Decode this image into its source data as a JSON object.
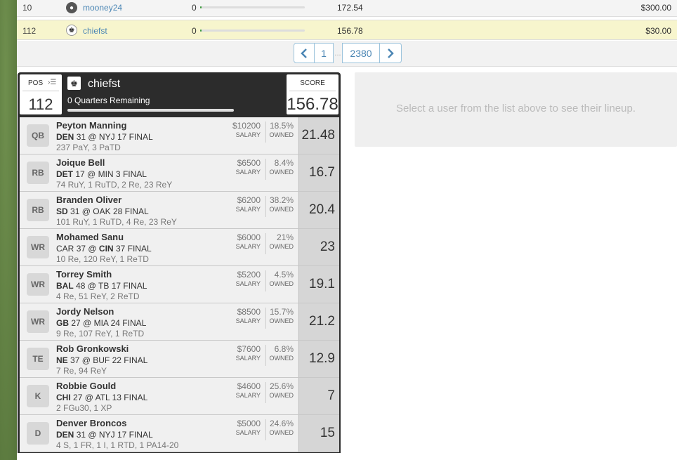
{
  "standings": [
    {
      "rank": "10",
      "username": "mooney24",
      "remaining": "0",
      "remaining_pct": 1,
      "points": "172.54",
      "prize": "$300.00"
    },
    {
      "rank": "112",
      "username": "chiefst",
      "remaining": "0",
      "remaining_pct": 1,
      "points": "156.78",
      "prize": "$30.00"
    }
  ],
  "pagination": {
    "first": "1",
    "dots": "...",
    "last": "2380"
  },
  "lineup": {
    "pos_label": "POS",
    "position": "112",
    "username": "chiefst",
    "quarters_remaining": "0 Quarters Remaining",
    "score_label": "SCORE",
    "score": "156.78",
    "salary_label": "SALARY",
    "owned_label": "OWNED",
    "players": [
      {
        "pos": "QB",
        "name": "Peyton Manning",
        "team": "DEN",
        "team_score": "31",
        "sep": "@",
        "opp": "NYJ",
        "opp_score": "17",
        "status": "FINAL",
        "stats": "237 PaY, 3 PaTD",
        "salary": "$10200",
        "owned": "18.5%",
        "points": "21.48",
        "bold": "team"
      },
      {
        "pos": "RB",
        "name": "Joique Bell",
        "team": "DET",
        "team_score": "17",
        "sep": "@",
        "opp": "MIN",
        "opp_score": "3",
        "status": "FINAL",
        "stats": "74 RuY, 1 RuTD, 2 Re, 23 ReY",
        "salary": "$6500",
        "owned": "8.4%",
        "points": "16.7",
        "bold": "team"
      },
      {
        "pos": "RB",
        "name": "Branden Oliver",
        "team": "SD",
        "team_score": "31",
        "sep": "@",
        "opp": "OAK",
        "opp_score": "28",
        "status": "FINAL",
        "stats": "101 RuY, 1 RuTD, 4 Re, 23 ReY",
        "salary": "$6200",
        "owned": "38.2%",
        "points": "20.4",
        "bold": "team"
      },
      {
        "pos": "WR",
        "name": "Mohamed Sanu",
        "team": "CAR",
        "team_score": "37",
        "sep": "@",
        "opp": "CIN",
        "opp_score": "37",
        "status": "FINAL",
        "stats": "10 Re, 120 ReY, 1 ReTD",
        "salary": "$6000",
        "owned": "21%",
        "points": "23",
        "bold": "opp"
      },
      {
        "pos": "WR",
        "name": "Torrey Smith",
        "team": "BAL",
        "team_score": "48",
        "sep": "@",
        "opp": "TB",
        "opp_score": "17",
        "status": "FINAL",
        "stats": "4 Re, 51 ReY, 2 ReTD",
        "salary": "$5200",
        "owned": "4.5%",
        "points": "19.1",
        "bold": "team"
      },
      {
        "pos": "WR",
        "name": "Jordy Nelson",
        "team": "GB",
        "team_score": "27",
        "sep": "@",
        "opp": "MIA",
        "opp_score": "24",
        "status": "FINAL",
        "stats": "9 Re, 107 ReY, 1 ReTD",
        "salary": "$8500",
        "owned": "15.7%",
        "points": "21.2",
        "bold": "team"
      },
      {
        "pos": "TE",
        "name": "Rob Gronkowski",
        "team": "NE",
        "team_score": "37",
        "sep": "@",
        "opp": "BUF",
        "opp_score": "22",
        "status": "FINAL",
        "stats": "7 Re, 94 ReY",
        "salary": "$7600",
        "owned": "6.8%",
        "points": "12.9",
        "bold": "team"
      },
      {
        "pos": "K",
        "name": "Robbie Gould",
        "team": "CHI",
        "team_score": "27",
        "sep": "@",
        "opp": "ATL",
        "opp_score": "13",
        "status": "FINAL",
        "stats": "2 FGu30, 1 XP",
        "salary": "$4600",
        "owned": "25.6%",
        "points": "7",
        "bold": "team"
      },
      {
        "pos": "D",
        "name": "Denver Broncos",
        "team": "DEN",
        "team_score": "31",
        "sep": "@",
        "opp": "NYJ",
        "opp_score": "17",
        "status": "FINAL",
        "stats": "4 S, 1 FR, 1 I, 1 RTD, 1 PA14-20",
        "salary": "$5000",
        "owned": "24.6%",
        "points": "15",
        "bold": "team"
      }
    ]
  },
  "info_panel": {
    "message": "Select a user from the list above to see their lineup."
  },
  "colors": {
    "link": "#4b86b4",
    "highlight_row": "#f7f5cd",
    "progress": "#3c9a3c",
    "header_bg": "#2c2c2c"
  }
}
